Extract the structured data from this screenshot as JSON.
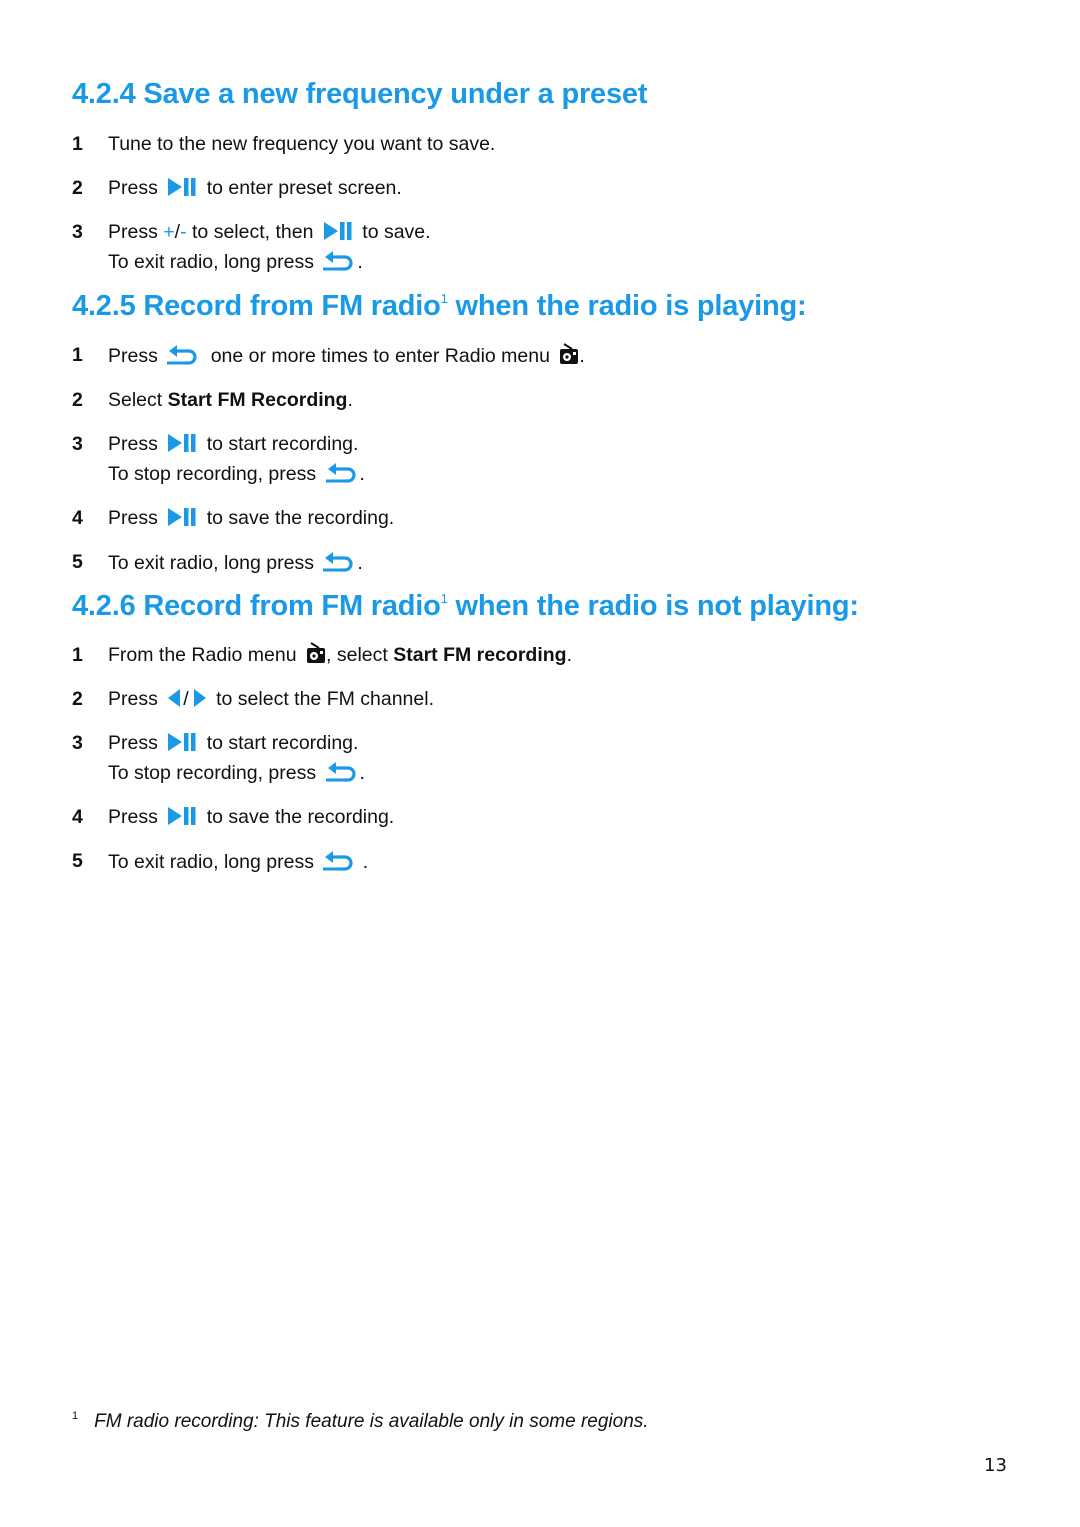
{
  "colors": {
    "accent": "#1a9ae6",
    "text": "#111111"
  },
  "icons": {
    "play_pause": "play-pause-icon",
    "back": "back-arrow-icon",
    "radio": "radio-icon",
    "left": "left-arrow-icon",
    "right": "right-arrow-icon"
  },
  "sections": [
    {
      "number": "4.2.4",
      "title": "Save a new frequency under a preset",
      "steps": [
        {
          "num": "1",
          "text": "Tune to the new frequency you want to save."
        },
        {
          "num": "2",
          "pre": "Press",
          "post": "to enter preset screen."
        },
        {
          "num": "3",
          "pre": "Press",
          "plus": "+",
          "slash": "/",
          "minus": "-",
          "mid": "to select, then",
          "post": "to save.",
          "line2_pre": "To exit radio, long press",
          "line2_post": "."
        }
      ]
    },
    {
      "number": "4.2.5",
      "title_a": "Record from FM radio",
      "footnote_ref": "1",
      "title_b": " when the radio is playing:",
      "steps": [
        {
          "num": "1",
          "pre": "Press",
          "mid": "one or more times to enter Radio menu",
          "post": "."
        },
        {
          "num": "2",
          "pre": "Select ",
          "bold": "Start FM Recording",
          "post": "."
        },
        {
          "num": "3",
          "pre": "Press",
          "post": "to start recording.",
          "line2_pre": "To stop recording, press",
          "line2_post": "."
        },
        {
          "num": "4",
          "pre": "Press",
          "post": "to save the recording."
        },
        {
          "num": "5",
          "pre": "To exit radio, long press",
          "post": "."
        }
      ]
    },
    {
      "number": "4.2.6",
      "title_a": "Record from FM radio",
      "footnote_ref": "1",
      "title_b": " when the radio is not playing:",
      "steps": [
        {
          "num": "1",
          "pre": "From the Radio menu",
          "mid": ", select ",
          "bold": "Start FM recording",
          "post": "."
        },
        {
          "num": "2",
          "pre": "Press",
          "slash": "/",
          "post": "to select the FM channel."
        },
        {
          "num": "3",
          "pre": "Press",
          "post": "to start recording.",
          "line2_pre": "To stop recording, press",
          "line2_post": "."
        },
        {
          "num": "4",
          "pre": "Press",
          "post": "to save the recording."
        },
        {
          "num": "5",
          "pre": "To exit radio, long press",
          "post": " ."
        }
      ]
    }
  ],
  "footnote": {
    "mark": "1",
    "text": "FM radio recording: This feature is available only in some regions."
  },
  "page_number": "13"
}
